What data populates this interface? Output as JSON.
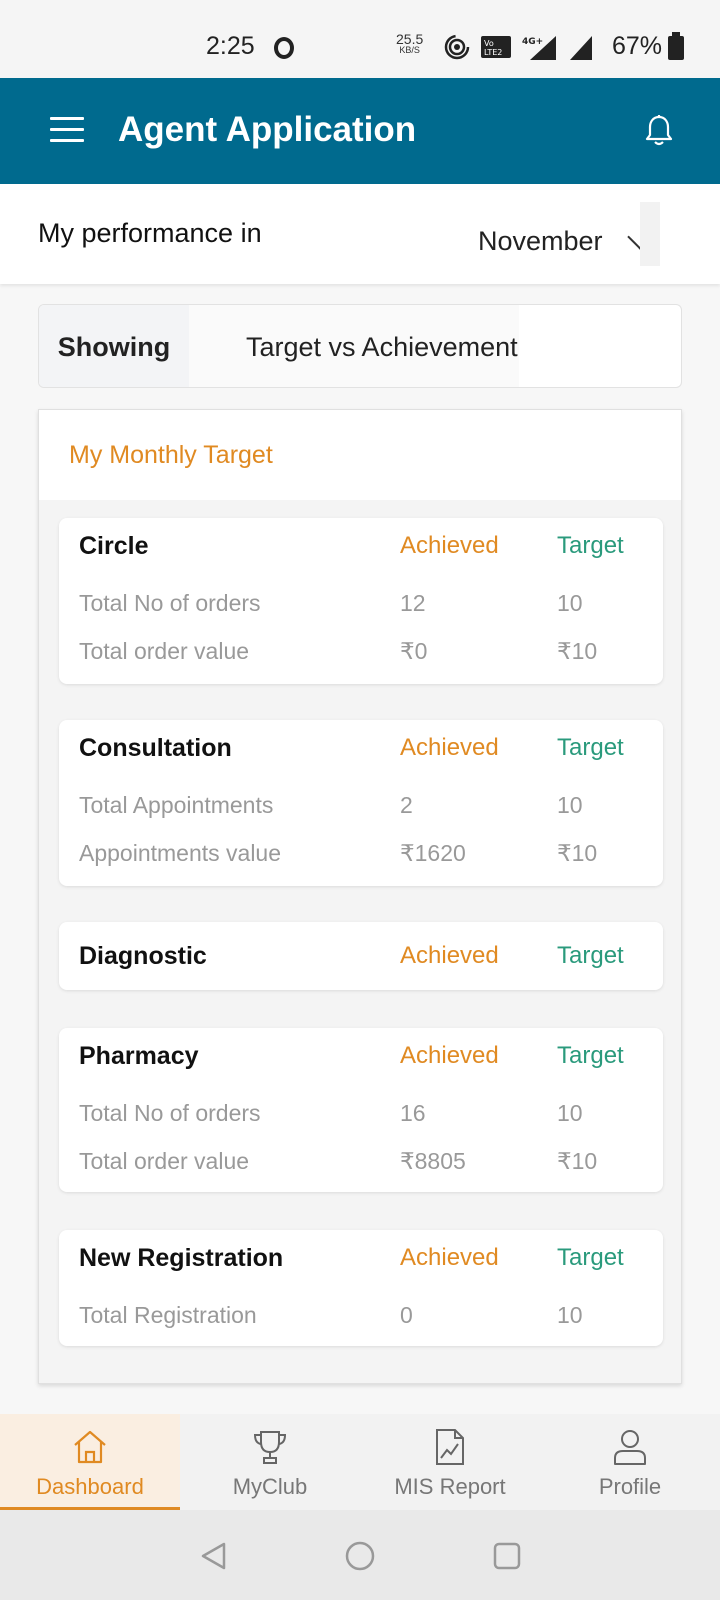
{
  "status_bar": {
    "time": "2:25",
    "net_speed_value": "25.5",
    "net_speed_unit": "KB/S",
    "volte_label": "Vo LTE 2",
    "network": "4G+",
    "battery_percent": "67%"
  },
  "app_bar": {
    "title": "Agent Application",
    "menu_icon": "hamburger-menu-icon",
    "notification_icon": "bell-icon"
  },
  "performance": {
    "label": "My performance in",
    "selected_month": "November"
  },
  "showing": {
    "label": "Showing",
    "value": "Target vs Achievement"
  },
  "monthly_target": {
    "title": "My Monthly Target",
    "colors": {
      "achieved": "#e08a22",
      "target": "#2a9a7c"
    },
    "cards": [
      {
        "name": "Circle",
        "achieved_label": "Achieved",
        "target_label": "Target",
        "rows": [
          {
            "metric": "Total No of orders",
            "achieved": "12",
            "target": "10"
          },
          {
            "metric": "Total order value",
            "achieved": "₹0",
            "target": "₹10"
          }
        ]
      },
      {
        "name": "Consultation",
        "achieved_label": "Achieved",
        "target_label": "Target",
        "rows": [
          {
            "metric": "Total Appointments",
            "achieved": "2",
            "target": "10"
          },
          {
            "metric": "Appointments value",
            "achieved": "₹1620",
            "target": "₹10"
          }
        ]
      },
      {
        "name": "Diagnostic",
        "achieved_label": "Achieved",
        "target_label": "Target",
        "rows": []
      },
      {
        "name": "Pharmacy",
        "achieved_label": "Achieved",
        "target_label": "Target",
        "rows": [
          {
            "metric": "Total No of orders",
            "achieved": "16",
            "target": "10"
          },
          {
            "metric": "Total order value",
            "achieved": "₹8805",
            "target": "₹10"
          }
        ]
      },
      {
        "name": "New Registration",
        "achieved_label": "Achieved",
        "target_label": "Target",
        "rows": [
          {
            "metric": "Total Registration",
            "achieved": "0",
            "target": "10"
          }
        ]
      }
    ]
  },
  "bottom_nav": {
    "items": [
      {
        "label": "Dashboard",
        "icon": "home-icon",
        "active": true
      },
      {
        "label": "MyClub",
        "icon": "trophy-icon",
        "active": false
      },
      {
        "label": "MIS Report",
        "icon": "report-chart-icon",
        "active": false
      },
      {
        "label": "Profile",
        "icon": "user-icon",
        "active": false
      }
    ]
  },
  "system_nav": {
    "back": "back-triangle-icon",
    "home": "home-circle-icon",
    "recents": "recents-square-icon"
  }
}
